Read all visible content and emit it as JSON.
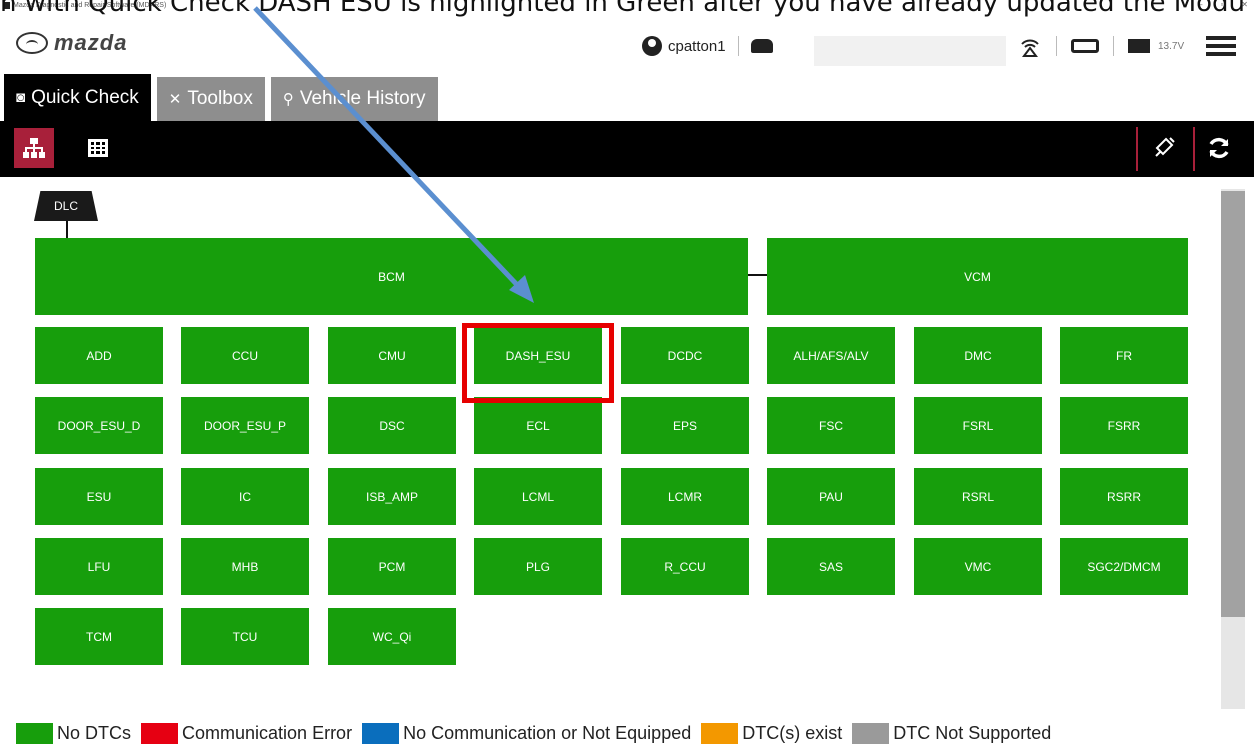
{
  "caption": "n with Quick Check DASH ESU is highlighted in Green after you have already updated the Modu",
  "window": {
    "title": "Mazda Diagnostic and Repair Software (MDARS)",
    "controls": [
      "–",
      "▫",
      "✕"
    ]
  },
  "header": {
    "brand": "mazda",
    "username": "cpatton1",
    "vin": "",
    "voltage": "13.7V",
    "icons": [
      "user-icon",
      "car-icon",
      "wireless-icon",
      "obd-icon",
      "battery-icon",
      "menu-icon"
    ]
  },
  "tabs": [
    {
      "label": "Quick Check",
      "icon": "camera-icon",
      "active": true
    },
    {
      "label": "Toolbox",
      "icon": "tools-icon",
      "active": false
    },
    {
      "label": "Vehicle History",
      "icon": "history-icon",
      "active": false
    }
  ],
  "toolbar": {
    "left": [
      "topology-view-icon",
      "grid-view-icon"
    ],
    "right": [
      "clear-dtc-icon",
      "refresh-icon"
    ]
  },
  "topology": {
    "dlc_label": "DLC",
    "bus_modules": [
      "BCM",
      "VCM"
    ],
    "modules": [
      "ADD",
      "CCU",
      "CMU",
      "DASH_ESU",
      "DCDC",
      "ALH/AFS/ALV",
      "DMC",
      "FR",
      "DOOR_ESU_D",
      "DOOR_ESU_P",
      "DSC",
      "ECL",
      "EPS",
      "FSC",
      "FSRL",
      "FSRR",
      "ESU",
      "IC",
      "ISB_AMP",
      "LCML",
      "LCMR",
      "PAU",
      "RSRL",
      "RSRR",
      "LFU",
      "MHB",
      "PCM",
      "PLG",
      "R_CCU",
      "SAS",
      "VMC",
      "SGC2/DMCM",
      "TCM",
      "TCU",
      "WC_Qi"
    ],
    "module_status": "No DTCs",
    "highlighted_module": "DASH_ESU"
  },
  "legend": [
    {
      "label": "No DTCs",
      "color": "#179e0c"
    },
    {
      "label": "Communication Error",
      "color": "#e60012"
    },
    {
      "label": "No Communication or Not Equipped",
      "color": "#0a6ebd"
    },
    {
      "label": "DTC(s) exist",
      "color": "#f39800"
    },
    {
      "label": "DTC Not Supported",
      "color": "#9a9a9a"
    }
  ],
  "colors": {
    "module_green": "#179e0c",
    "toolbar_bg": "#000000",
    "accent": "#a8203a",
    "highlight": "#e60000",
    "arrow": "#5b8fd0"
  }
}
